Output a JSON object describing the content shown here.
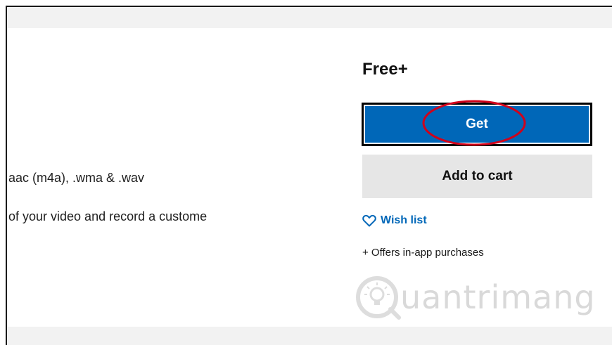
{
  "description": {
    "line1": "aac (m4a), .wma & .wav",
    "line2": "of your video and record a custome"
  },
  "purchase": {
    "price": "Free+",
    "get_label": "Get",
    "add_to_cart_label": "Add to cart",
    "wishlist_label": "Wish list",
    "offers_label": "+ Offers in-app purchases"
  },
  "watermark": {
    "text": "uantrimang"
  },
  "colors": {
    "accent": "#0067b8",
    "highlight": "#d0021b",
    "cart_bg": "#e6e6e6"
  },
  "icons": {
    "wishlist": "heart-outline-icon",
    "watermark": "lightbulb-logo-icon"
  }
}
